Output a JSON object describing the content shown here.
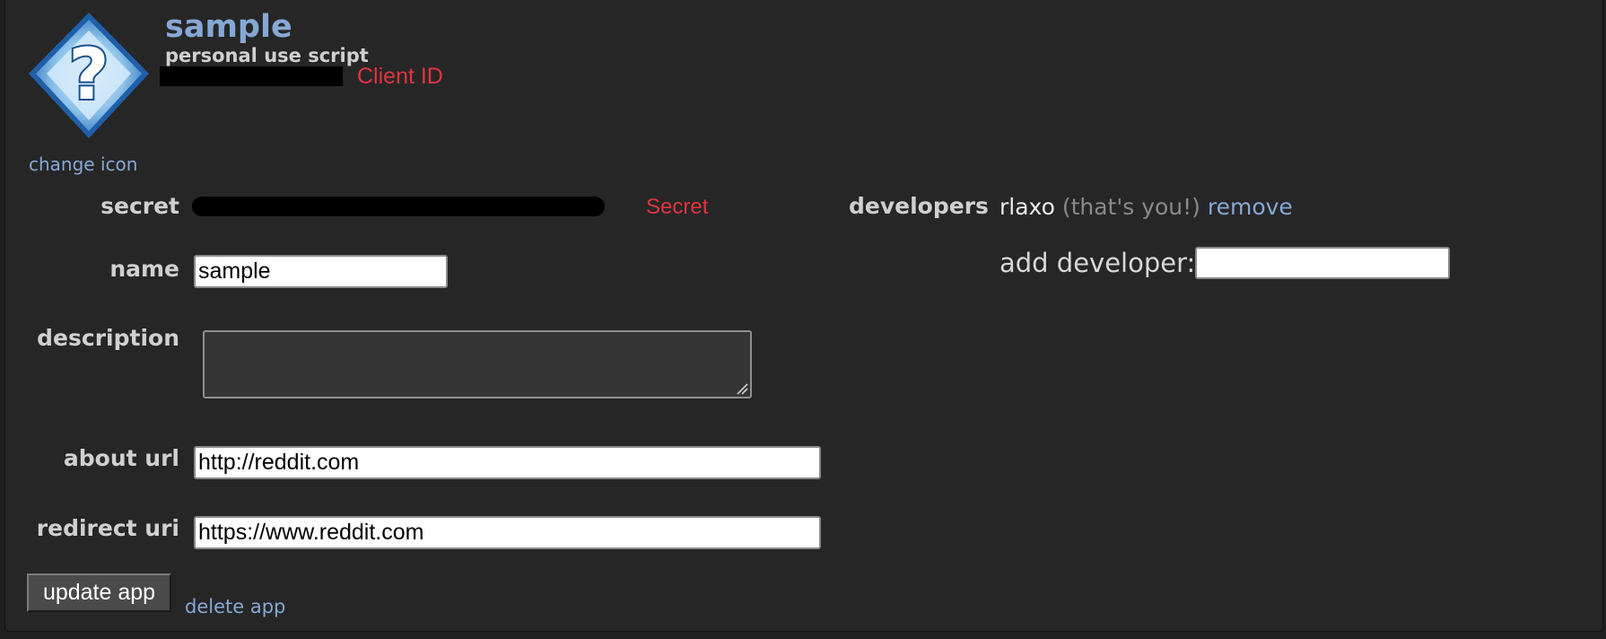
{
  "app": {
    "name": "sample",
    "type": "personal use script",
    "client_id_label": "Client ID",
    "change_icon": "change icon"
  },
  "labels": {
    "secret": "secret",
    "secret_note": "Secret",
    "name": "name",
    "description": "description",
    "about_url": "about url",
    "redirect_uri": "redirect uri",
    "developers": "developers",
    "add_developer": "add developer:"
  },
  "fields": {
    "name": "sample",
    "description": "",
    "about_url": "http://reddit.com",
    "redirect_uri": "https://www.reddit.com",
    "add_developer": ""
  },
  "developers": {
    "user": "rlaxo",
    "you_note": "(that's you!)",
    "remove": "remove"
  },
  "buttons": {
    "update": "update app",
    "delete": "delete app"
  },
  "icon": "question-mark-diamond-icon"
}
